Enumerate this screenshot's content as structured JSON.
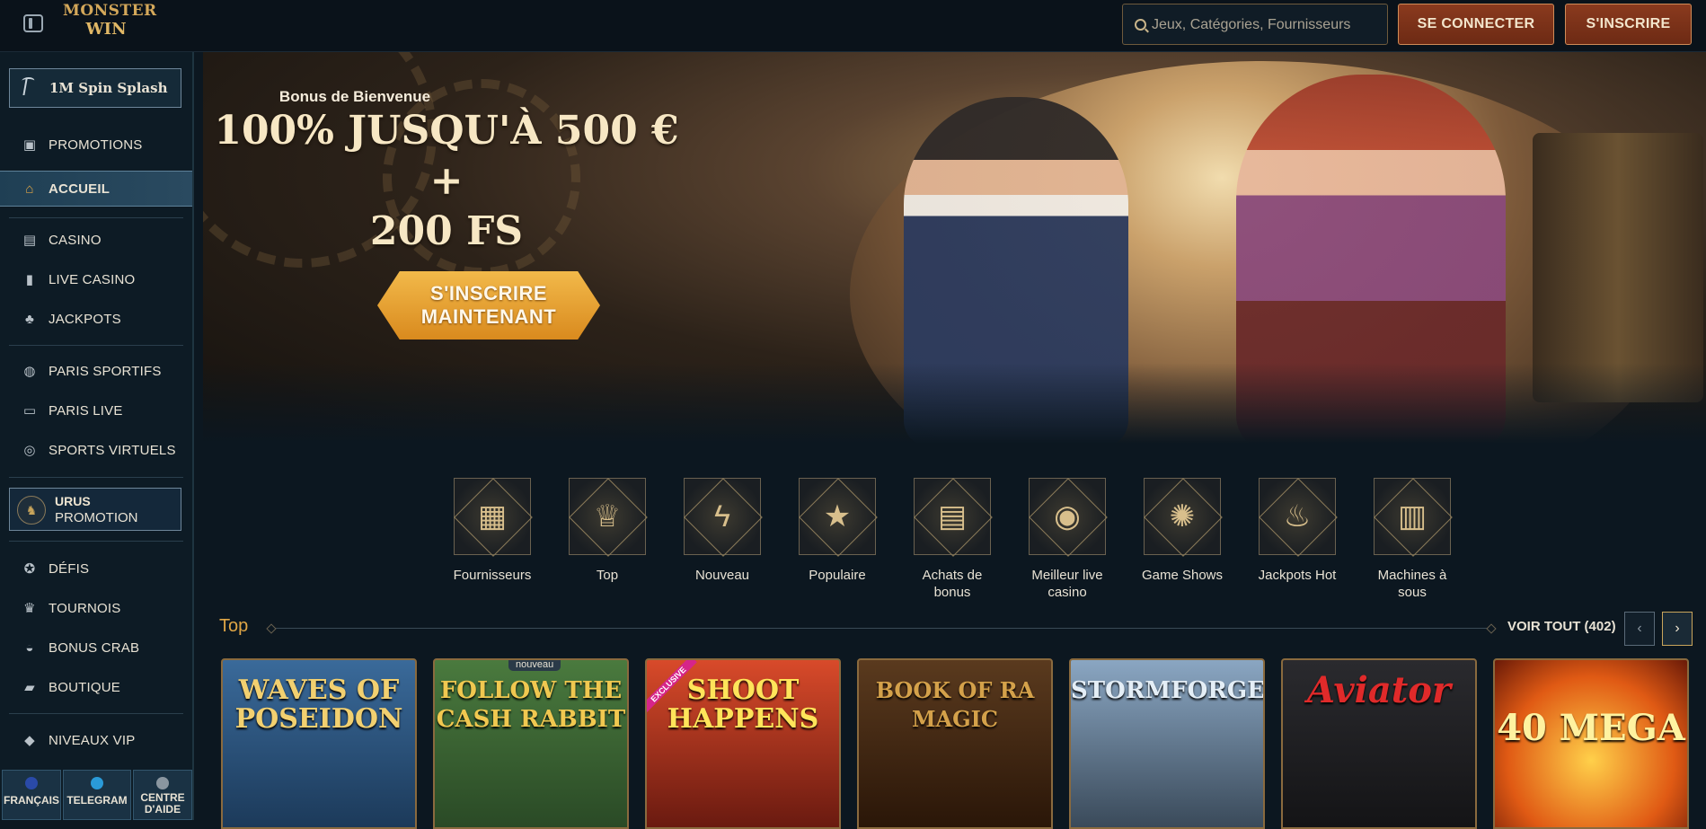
{
  "header": {
    "logo_line1": "MONSTER",
    "logo_line2": "WIN",
    "search_placeholder": "Jeux, Catégories, Fournisseurs",
    "login_label": "SE CONNECTER",
    "signup_label": "S'INSCRIRE"
  },
  "sidebar": {
    "promo_label": "1M Spin Splash",
    "items": [
      {
        "label": "PROMOTIONS",
        "icon": "gift-icon"
      },
      {
        "label": "ACCUEIL",
        "icon": "home-icon"
      },
      {
        "label": "CASINO",
        "icon": "slot-machine-icon"
      },
      {
        "label": "LIVE CASINO",
        "icon": "card-icon"
      },
      {
        "label": "JACKPOTS",
        "icon": "clover-icon"
      },
      {
        "label": "PARIS SPORTIFS",
        "icon": "ball-icon"
      },
      {
        "label": "PARIS LIVE",
        "icon": "live-icon"
      },
      {
        "label": "SPORTS VIRTUELS",
        "icon": "virtual-icon"
      },
      {
        "label": "DÉFIS",
        "icon": "badge-icon"
      },
      {
        "label": "TOURNOIS",
        "icon": "trophy-icon"
      },
      {
        "label": "BONUS CRAB",
        "icon": "crab-icon"
      },
      {
        "label": "BOUTIQUE",
        "icon": "basket-icon"
      },
      {
        "label": "NIVEAUX VIP",
        "icon": "diamond-icon"
      }
    ],
    "urus_title": "URUS",
    "urus_sub": "PROMOTION",
    "footer": [
      {
        "label": "FRANÇAIS"
      },
      {
        "label": "TELEGRAM"
      },
      {
        "label": "CENTRE D'AIDE"
      }
    ]
  },
  "hero": {
    "subtitle": "Bonus de Bienvenue",
    "title_line1": "100% JUSQU'À 500 € +",
    "title_line2": "200 FS",
    "cta_line1": "S'INSCRIRE",
    "cta_line2": "MAINTENANT"
  },
  "categories": [
    {
      "label": "Fournisseurs",
      "icon": "book-icon"
    },
    {
      "label": "Top",
      "icon": "crown-icon"
    },
    {
      "label": "Nouveau",
      "icon": "lightning-icon"
    },
    {
      "label": "Populaire",
      "icon": "star-icon"
    },
    {
      "label": "Achats de bonus",
      "icon": "chest-icon"
    },
    {
      "label": "Meilleur live casino",
      "icon": "chip-icon"
    },
    {
      "label": "Game Shows",
      "icon": "wheel-icon"
    },
    {
      "label": "Jackpots Hot",
      "icon": "flame-icon"
    },
    {
      "label": "Machines à sous",
      "icon": "slot-icon"
    }
  ],
  "top_section": {
    "title": "Top",
    "see_all": "VOIR TOUT (402)",
    "games": [
      {
        "title": "WAVES OF POSEIDON",
        "bg": "#2b5a8a"
      },
      {
        "title": "FOLLOW THE CASH RABBIT",
        "tag": "nouveau",
        "bg": "#3e6a3a"
      },
      {
        "title": "SHOOT HAPPENS",
        "tag": "EXCLUSIVE",
        "bg": "#b8352a"
      },
      {
        "title": "BOOK OF RA MAGIC",
        "bg": "#4a2a14"
      },
      {
        "title": "STORMFORGED",
        "bg": "#6a8aa6"
      },
      {
        "title": "Aviator",
        "bg": "#1e1e22"
      },
      {
        "title": "40 MEGA",
        "bg": "#c4541a"
      }
    ]
  }
}
